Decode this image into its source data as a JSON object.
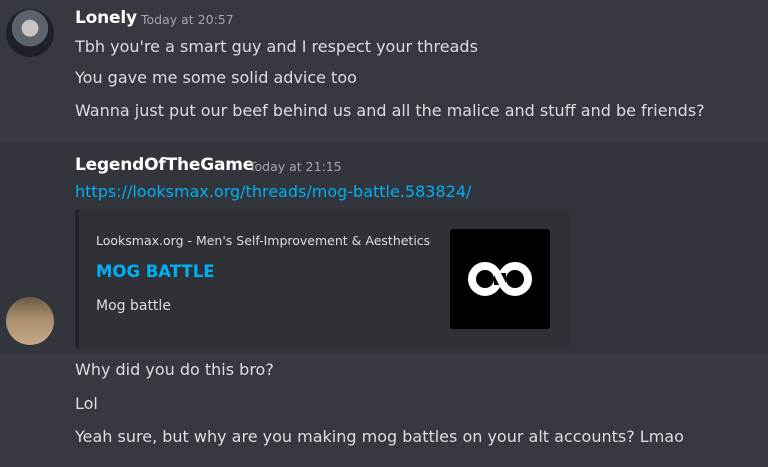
{
  "messages": [
    {
      "author": "Lonely",
      "timestamp": "Today at 20:57",
      "lines": [
        "Tbh you're a smart guy and I respect your threads",
        "You gave me some solid advice too",
        "Wanna just put our beef behind us and all the malice and stuff and be friends?"
      ]
    },
    {
      "author": "LegendOfTheGame",
      "timestamp": "Today at 21:15",
      "link": "https://looksmax.org/threads/mog-battle.583824/",
      "embed": {
        "provider": "Looksmax.org - Men's Self-Improvement & Aesthetics",
        "title": "MOG BATTLE",
        "description": "Mog battle",
        "thumbnail_icon": "infinity-logo-icon"
      }
    },
    {
      "lines": [
        "Why did you do this bro?",
        "Lol",
        "Yeah sure, but why are you making mog battles on your alt accounts? Lmao"
      ]
    }
  ],
  "colors": {
    "background": "#36393f",
    "text": "#dcddde",
    "link": "#00aff4",
    "embed_bg": "#2f3136",
    "timestamp": "#a3a6aa"
  }
}
